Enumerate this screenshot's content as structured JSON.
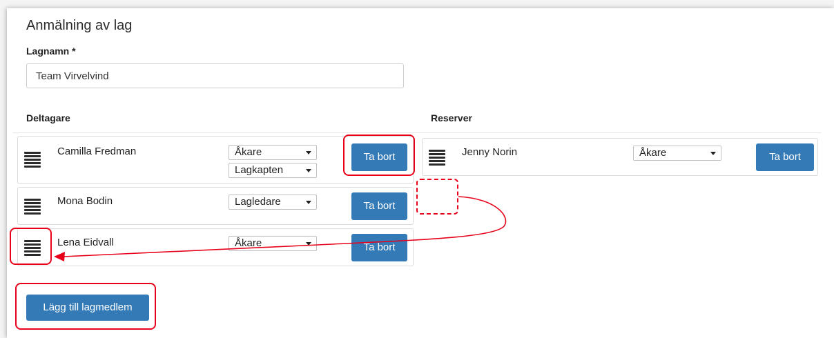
{
  "form": {
    "title": "Anmälning av lag",
    "team_name_label": "Lagnamn *",
    "team_name_value": "Team Virvelvind"
  },
  "participants": {
    "header": "Deltagare",
    "members": [
      {
        "name": "Camilla Fredman",
        "role": "Åkare",
        "extra_role": "Lagkapten",
        "remove_label": "Ta bort"
      },
      {
        "name": "Mona Bodin",
        "role": "Lagledare",
        "remove_label": "Ta bort"
      },
      {
        "name": "Lena Eidvall",
        "role": "Åkare",
        "remove_label": "Ta bort"
      }
    ]
  },
  "reserves": {
    "header": "Reserver",
    "members": [
      {
        "name": "Jenny Norin",
        "role": "Åkare",
        "remove_label": "Ta bort"
      }
    ]
  },
  "add_member_label": "Lägg till lagmedlem",
  "colors": {
    "button": "#337ab7",
    "annotation": "#e8001a"
  }
}
